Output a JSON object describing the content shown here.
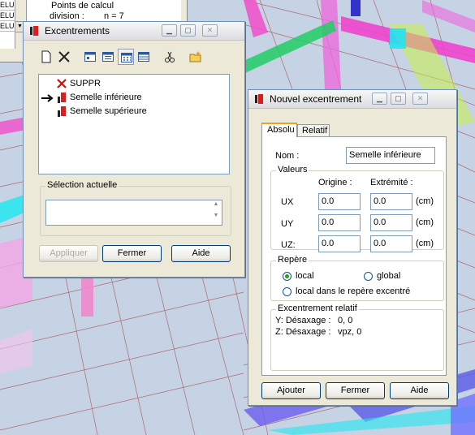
{
  "top_window": {
    "cells": [
      "ELU",
      "ELU",
      "ELU"
    ],
    "line1": "Points de calcul",
    "line2_label": "division :",
    "line2_value": "n = 7"
  },
  "excentrements": {
    "title": "Excentrements",
    "toolbar": [
      "new-icon",
      "delete-icon",
      "view-icon",
      "view-icon",
      "grid-view-icon",
      "table-view-icon",
      "cut-icon",
      "open-folder-icon"
    ],
    "items": [
      {
        "label": "SUPPR",
        "icon": "red-x-icon",
        "current": false
      },
      {
        "label": "Semelle inférieure",
        "icon": "offset-icon",
        "current": true
      },
      {
        "label": "Semelle supérieure",
        "icon": "offset-icon",
        "current": false
      }
    ],
    "selection_group": "Sélection actuelle",
    "selection_value": "",
    "buttons": {
      "apply": "Appliquer",
      "close": "Fermer",
      "help": "Aide"
    }
  },
  "nouvel": {
    "title": "Nouvel excentrement",
    "tabs": {
      "absolu": "Absolu",
      "relatif": "Relatif"
    },
    "nom_label": "Nom :",
    "nom_value": "Semelle inférieure",
    "valeurs_group": "Valeurs",
    "col_origine": "Origine :",
    "col_extremite": "Extrémité :",
    "rows": [
      {
        "label": "UX",
        "origin": "0.0",
        "end": "0.0",
        "unit": "(cm)"
      },
      {
        "label": "UY",
        "origin": "0.0",
        "end": "0.0",
        "unit": "(cm)"
      },
      {
        "label": "UZ:",
        "origin": "0.0",
        "end": "0.0",
        "unit": "(cm)"
      }
    ],
    "repere_group": "Repère",
    "repere_local": "local",
    "repere_global": "global",
    "repere_excentre": "local dans le repère excentré",
    "repere_selected": "local",
    "relatif_group": "Excentrement relatif",
    "relatif_y_label": "Y: Désaxage :",
    "relatif_y_value": "0, 0",
    "relatif_z_label": "Z: Désaxage :",
    "relatif_z_value": "vpz, 0",
    "buttons": {
      "add": "Ajouter",
      "close": "Fermer",
      "help": "Aide"
    }
  },
  "colors": {
    "window_bg": "#ece9d8",
    "border_blue": "#7f9db9",
    "beam_pink": "#ee44cc",
    "beam_green": "#22cc66",
    "beam_cyan": "#22e0ee",
    "mesh_red": "#b04040"
  }
}
